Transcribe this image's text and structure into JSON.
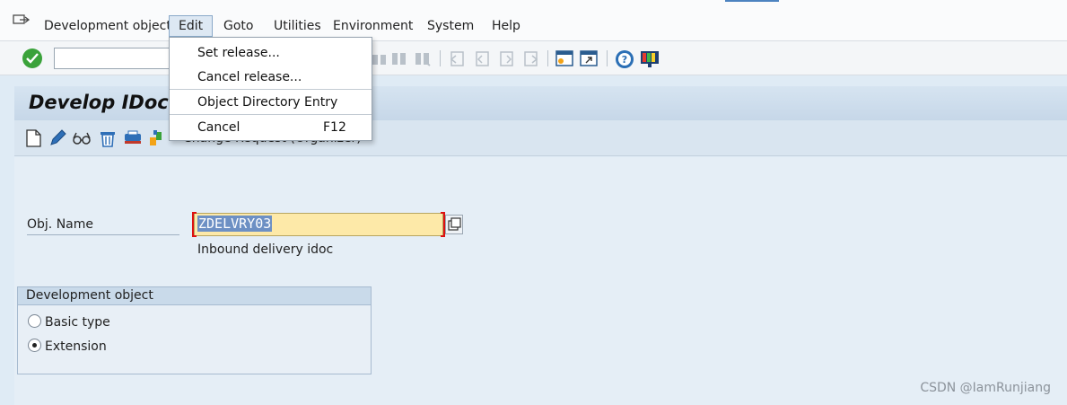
{
  "menu": {
    "items": [
      "Development object",
      "Edit",
      "Goto",
      "Utilities",
      "Environment",
      "System",
      "Help"
    ],
    "active": "Edit"
  },
  "toolbar": {
    "command_value": ""
  },
  "title": "Develop IDoc T",
  "app_toolbar": {
    "text": "Change Request (Organizer)"
  },
  "form": {
    "obj_label": "Obj. Name",
    "obj_value": "ZDELVRY03",
    "obj_description": "Inbound delivery idoc"
  },
  "group": {
    "title": "Development object",
    "options": [
      "Basic type",
      "Extension"
    ],
    "selected": "Extension"
  },
  "dropdown": {
    "items": [
      {
        "label": "Set release...",
        "accel": ""
      },
      {
        "label": "Cancel release...",
        "accel": ""
      },
      {
        "label": "Object Directory Entry",
        "accel": ""
      },
      {
        "label": "Cancel",
        "accel": "F12"
      }
    ]
  },
  "watermark": "CSDN @IamRunjiang",
  "colors": {
    "ok": "#3aa23a",
    "input_bg": "#fde9a8",
    "selection": "#6d90c4"
  }
}
